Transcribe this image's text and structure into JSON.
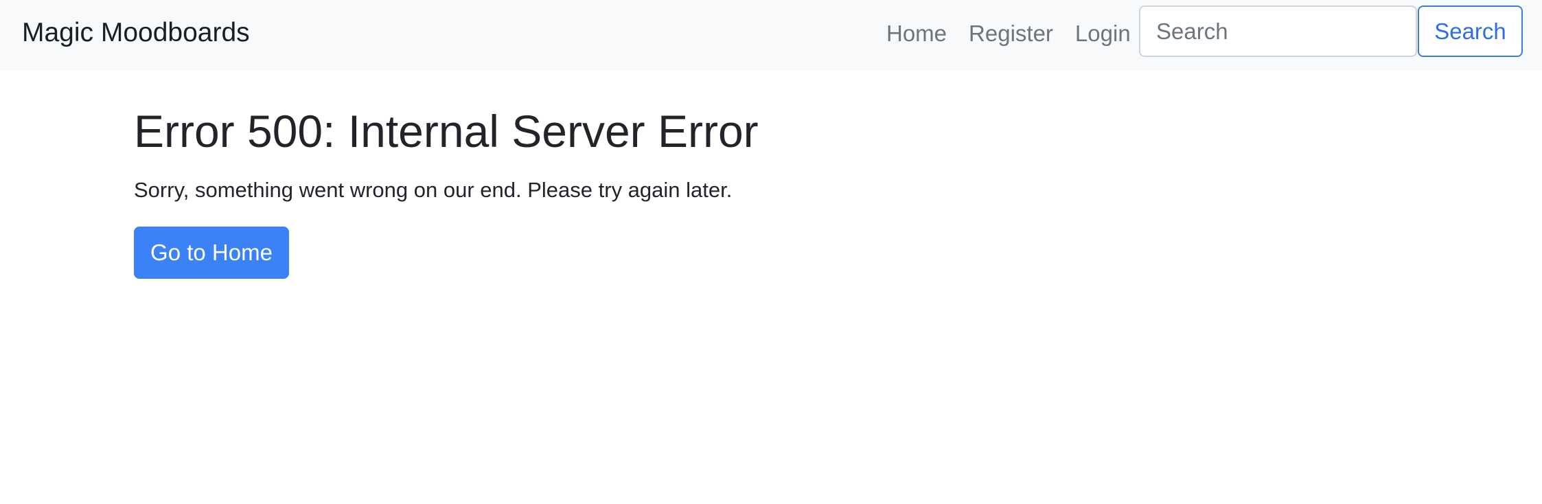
{
  "navbar": {
    "brand": "Magic Moodboards",
    "links": [
      {
        "label": "Home"
      },
      {
        "label": "Register"
      },
      {
        "label": "Login"
      }
    ],
    "search": {
      "placeholder": "Search",
      "value": "",
      "button_label": "Search"
    },
    "colors": {
      "background": "#f8f9fa",
      "link": "#6c757d",
      "search_button": "#2f6fe4"
    }
  },
  "main": {
    "title": "Error 500: Internal Server Error",
    "message": "Sorry, something went wrong on our end. Please try again later.",
    "home_button_label": "Go to Home",
    "colors": {
      "primary_button": "#3b82f6"
    }
  }
}
